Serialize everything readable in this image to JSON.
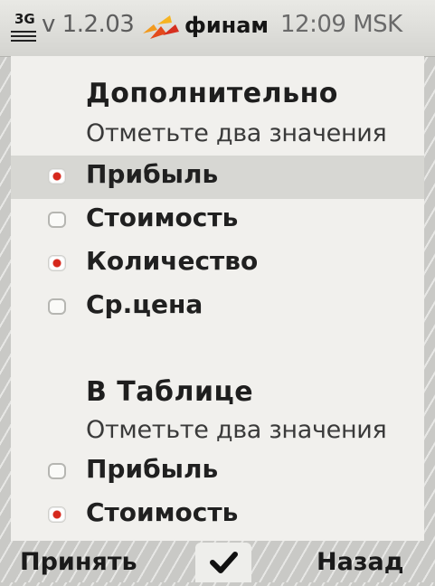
{
  "statusbar": {
    "network": "3G",
    "network_icon": "3g-signal-icon",
    "version": "v 1.2.03",
    "logo_icon": "finam-logo-icon",
    "brand": "финам",
    "time": "12:09 MSK"
  },
  "sections": [
    {
      "title": "Дополнительно",
      "hint": "Отметьте два значения",
      "options": [
        {
          "label": "Прибыль",
          "checked": true,
          "highlighted": true
        },
        {
          "label": "Стоимость",
          "checked": false
        },
        {
          "label": "Количество",
          "checked": true
        },
        {
          "label": "Ср.цена",
          "checked": false
        }
      ]
    },
    {
      "title": "В Таблице",
      "hint": "Отметьте два значения",
      "options": [
        {
          "label": "Прибыль",
          "checked": false
        },
        {
          "label": "Стоимость",
          "checked": true
        }
      ]
    }
  ],
  "softkeys": {
    "left": "Принять",
    "middle_icon": "checkmark-icon",
    "right": "Назад"
  },
  "colors": {
    "accent_red": "#d6281c",
    "logo_orange": "#f29a1e",
    "selection": "#d7d7d3",
    "panel": "#f1f0ed"
  }
}
